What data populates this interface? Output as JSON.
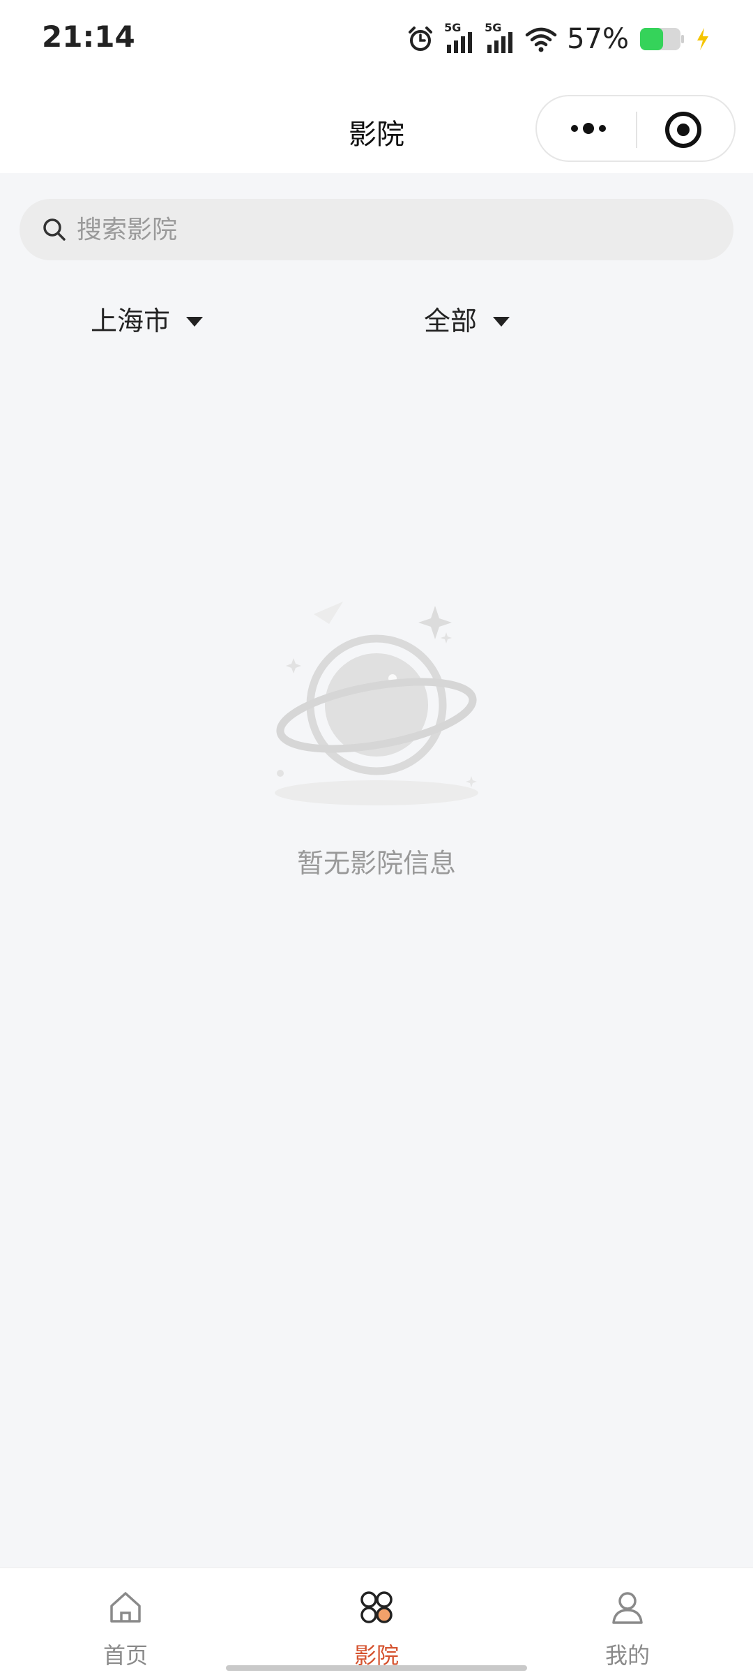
{
  "status_bar": {
    "time": "21:14",
    "signal_1_label": "5G",
    "signal_2_label": "5G",
    "battery_percent": "57%",
    "battery_level": 0.57,
    "icons": [
      "alarm-icon",
      "signal-icon",
      "signal-icon",
      "wifi-icon",
      "battery-icon",
      "charging-icon"
    ]
  },
  "nav": {
    "title": "影院",
    "more_icon": "more-dots-icon",
    "close_icon": "target-close-icon"
  },
  "search": {
    "placeholder": "搜索影院",
    "value": "",
    "icon": "search-icon"
  },
  "filters": {
    "city": "上海市",
    "type": "全部",
    "dropdown_icon": "caret-down-icon"
  },
  "empty_state": {
    "icon": "planet-icon",
    "message": "暂无影院信息"
  },
  "tabbar": {
    "items": [
      {
        "label": "首页",
        "icon": "home-icon",
        "active": false
      },
      {
        "label": "影院",
        "icon": "cinema-grid-icon",
        "active": true
      },
      {
        "label": "我的",
        "icon": "person-icon",
        "active": false
      }
    ],
    "active_color": "#d5532f",
    "inactive_color": "#8a8a8a"
  },
  "colors": {
    "background": "#f5f6f8",
    "accent": "#d5532f",
    "battery_fill": "#35d35a",
    "charging_bolt": "#f5c400"
  }
}
